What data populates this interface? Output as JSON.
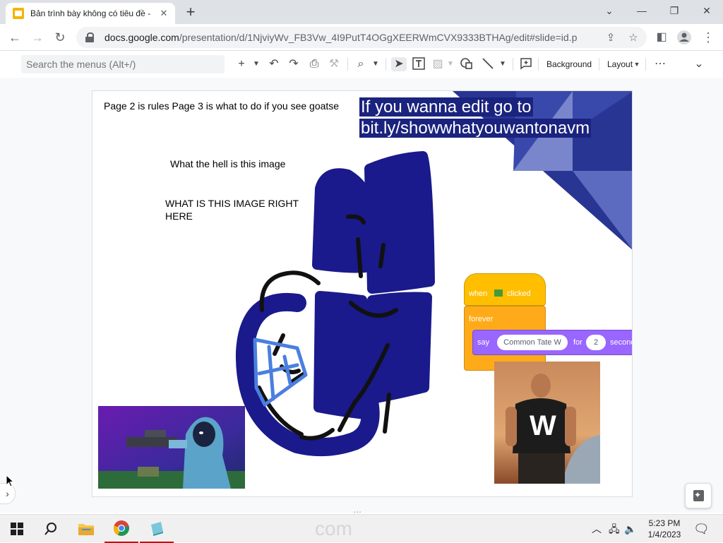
{
  "browser": {
    "tab_title": "Bản trình bày không có tiêu đề -",
    "url_host": "docs.google.com",
    "url_path": "/presentation/d/1NjviyWv_FB3Vw_4I9PutT4OGgXEERWmCVX9333BTHAg/edit#slide=id.p"
  },
  "slides_toolbar": {
    "search_placeholder": "Search the menus (Alt+/)",
    "background_label": "Background",
    "layout_label": "Layout"
  },
  "slide": {
    "note_text": "Page 2 is rules Page 3 is what to do if you see goatse",
    "banner_line1": "If you wanna edit go to",
    "banner_line2": "bit.ly/showwhatyouwantonavm",
    "question_text": "What the hell is this image",
    "shout_line1": "WHAT IS THIS IMAGE RIGHT",
    "shout_line2": "HERE",
    "scratch": {
      "hat_when": "when",
      "hat_clicked": "clicked",
      "forever_label": "forever",
      "say_label": "say",
      "say_message": "Common Tate W",
      "for_label": "for",
      "seconds_value": "2",
      "seconds_label": "seconds"
    },
    "tate_shirt_letter": "W"
  },
  "taskbar": {
    "watermark": "com",
    "time": "5:23 PM",
    "date": "1/4/2023"
  },
  "colors": {
    "accent_blue": "#1a237e",
    "scribble_blue": "#1a1a8c",
    "triangle_light": "#5c6bc0",
    "scratch_yellow": "#ffbf00",
    "scratch_orange": "#ffab19",
    "scratch_purple": "#9966ff"
  }
}
